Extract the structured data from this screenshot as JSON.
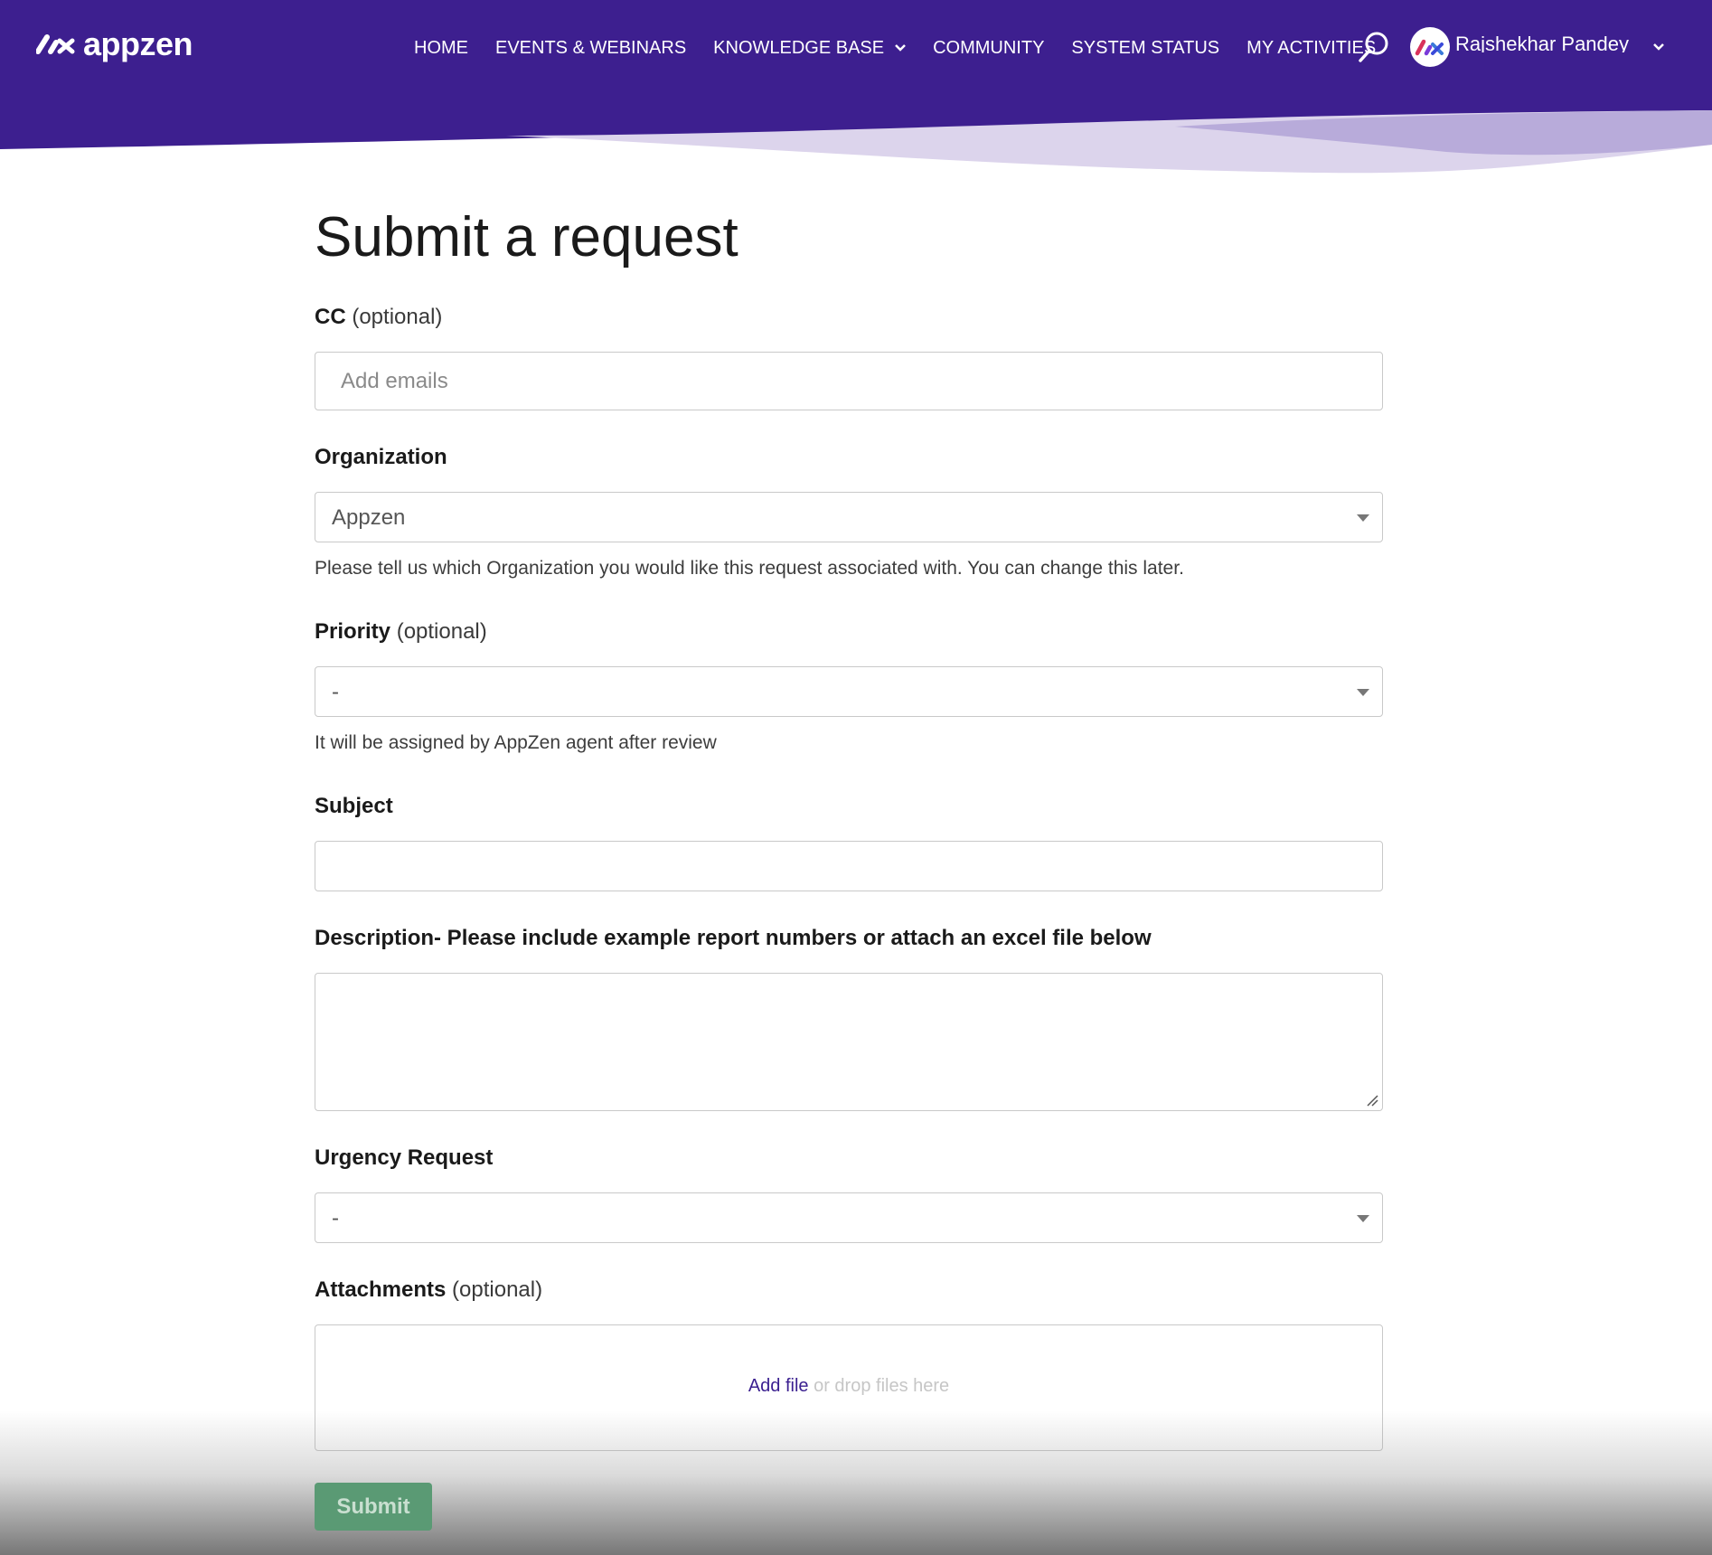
{
  "colors": {
    "header_bg": "#3d1f8f",
    "wave_light": "#dcd4ec",
    "wave_mid": "#b8abda",
    "link": "#3b2090",
    "submit_bg": "#5a9a74"
  },
  "brand": {
    "logo_text": "appzen",
    "logo_icon": "appzen-logo-icon"
  },
  "nav": {
    "items": [
      {
        "label": "HOME"
      },
      {
        "label": "EVENTS & WEBINARS"
      },
      {
        "label": "KNOWLEDGE BASE",
        "has_dropdown": true
      },
      {
        "label": "COMMUNITY"
      },
      {
        "label": "SYSTEM STATUS"
      },
      {
        "label": "MY ACTIVITIES"
      }
    ],
    "search_icon": "search-icon"
  },
  "user": {
    "name": "Rajshekhar Pandey",
    "avatar_icon": "appzen-avatar-icon"
  },
  "form": {
    "title": "Submit a request",
    "cc": {
      "label": "CC",
      "optional": "(optional)",
      "placeholder": "Add emails"
    },
    "organization": {
      "label": "Organization",
      "value": "Appzen",
      "hint": "Please tell us which Organization you would like this request associated with. You can change this later."
    },
    "priority": {
      "label": "Priority",
      "optional": "(optional)",
      "value": "-",
      "hint": "It will be assigned by AppZen agent after review"
    },
    "subject": {
      "label": "Subject",
      "value": ""
    },
    "description": {
      "label": "Description- Please include example report numbers or attach an excel file below",
      "value": ""
    },
    "urgency": {
      "label": "Urgency Request",
      "value": "-"
    },
    "attachments": {
      "label": "Attachments",
      "optional": "(optional)",
      "add_file": "Add file",
      "drop_hint": " or drop files here"
    },
    "submit_label": "Submit"
  }
}
